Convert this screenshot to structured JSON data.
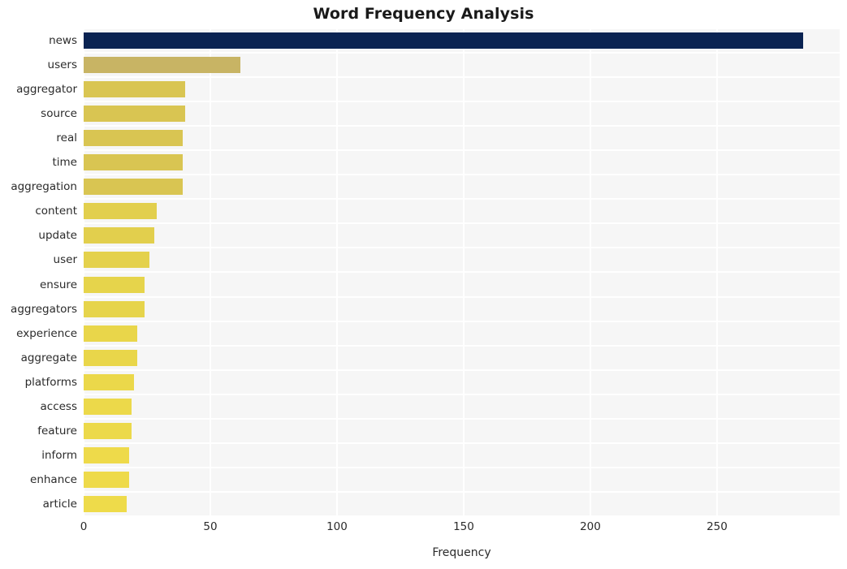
{
  "chart_data": {
    "type": "bar",
    "orientation": "horizontal",
    "title": "Word Frequency Analysis",
    "xlabel": "Frequency",
    "ylabel": "",
    "categories": [
      "news",
      "users",
      "aggregator",
      "source",
      "real",
      "time",
      "aggregation",
      "content",
      "update",
      "user",
      "ensure",
      "aggregators",
      "experience",
      "aggregate",
      "platforms",
      "access",
      "feature",
      "inform",
      "enhance",
      "article"
    ],
    "values": [
      284,
      62,
      40,
      40,
      39,
      39,
      39,
      29,
      28,
      26,
      24,
      24,
      21,
      21,
      20,
      19,
      19,
      18,
      18,
      17
    ],
    "bar_colors": [
      "#0a2352",
      "#c8b464",
      "#d9c552",
      "#d9c552",
      "#d9c552",
      "#d9c552",
      "#d9c552",
      "#e2cf4d",
      "#e2cf4d",
      "#e4d14c",
      "#e6d44b",
      "#e6d44b",
      "#e9d64a",
      "#e9d64a",
      "#ebd84a",
      "#ecd94a",
      "#ecd94a",
      "#eeda4a",
      "#eeda4a",
      "#eedb4a"
    ],
    "xticks": [
      0,
      50,
      100,
      150,
      200,
      250
    ],
    "xticklabels": [
      "0",
      "50",
      "100",
      "150",
      "200",
      "250"
    ],
    "xlim": [
      0,
      298.4
    ],
    "grid": true,
    "legend": false,
    "plot_background": "#f6f6f6",
    "gridline_color": "#ffffff",
    "figure_background": "#ffffff"
  }
}
